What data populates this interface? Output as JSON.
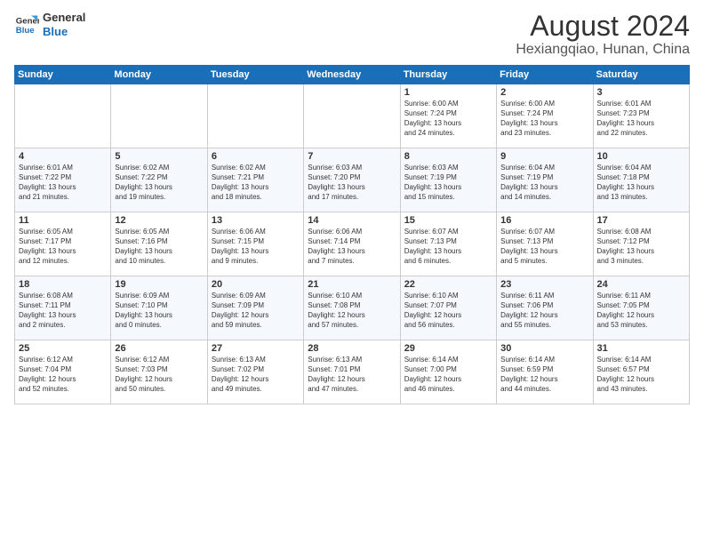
{
  "logo": {
    "line1": "General",
    "line2": "Blue"
  },
  "title": "August 2024",
  "subtitle": "Hexiangqiao, Hunan, China",
  "weekdays": [
    "Sunday",
    "Monday",
    "Tuesday",
    "Wednesday",
    "Thursday",
    "Friday",
    "Saturday"
  ],
  "weeks": [
    [
      {
        "day": "",
        "info": ""
      },
      {
        "day": "",
        "info": ""
      },
      {
        "day": "",
        "info": ""
      },
      {
        "day": "",
        "info": ""
      },
      {
        "day": "1",
        "info": "Sunrise: 6:00 AM\nSunset: 7:24 PM\nDaylight: 13 hours\nand 24 minutes."
      },
      {
        "day": "2",
        "info": "Sunrise: 6:00 AM\nSunset: 7:24 PM\nDaylight: 13 hours\nand 23 minutes."
      },
      {
        "day": "3",
        "info": "Sunrise: 6:01 AM\nSunset: 7:23 PM\nDaylight: 13 hours\nand 22 minutes."
      }
    ],
    [
      {
        "day": "4",
        "info": "Sunrise: 6:01 AM\nSunset: 7:22 PM\nDaylight: 13 hours\nand 21 minutes."
      },
      {
        "day": "5",
        "info": "Sunrise: 6:02 AM\nSunset: 7:22 PM\nDaylight: 13 hours\nand 19 minutes."
      },
      {
        "day": "6",
        "info": "Sunrise: 6:02 AM\nSunset: 7:21 PM\nDaylight: 13 hours\nand 18 minutes."
      },
      {
        "day": "7",
        "info": "Sunrise: 6:03 AM\nSunset: 7:20 PM\nDaylight: 13 hours\nand 17 minutes."
      },
      {
        "day": "8",
        "info": "Sunrise: 6:03 AM\nSunset: 7:19 PM\nDaylight: 13 hours\nand 15 minutes."
      },
      {
        "day": "9",
        "info": "Sunrise: 6:04 AM\nSunset: 7:19 PM\nDaylight: 13 hours\nand 14 minutes."
      },
      {
        "day": "10",
        "info": "Sunrise: 6:04 AM\nSunset: 7:18 PM\nDaylight: 13 hours\nand 13 minutes."
      }
    ],
    [
      {
        "day": "11",
        "info": "Sunrise: 6:05 AM\nSunset: 7:17 PM\nDaylight: 13 hours\nand 12 minutes."
      },
      {
        "day": "12",
        "info": "Sunrise: 6:05 AM\nSunset: 7:16 PM\nDaylight: 13 hours\nand 10 minutes."
      },
      {
        "day": "13",
        "info": "Sunrise: 6:06 AM\nSunset: 7:15 PM\nDaylight: 13 hours\nand 9 minutes."
      },
      {
        "day": "14",
        "info": "Sunrise: 6:06 AM\nSunset: 7:14 PM\nDaylight: 13 hours\nand 7 minutes."
      },
      {
        "day": "15",
        "info": "Sunrise: 6:07 AM\nSunset: 7:13 PM\nDaylight: 13 hours\nand 6 minutes."
      },
      {
        "day": "16",
        "info": "Sunrise: 6:07 AM\nSunset: 7:13 PM\nDaylight: 13 hours\nand 5 minutes."
      },
      {
        "day": "17",
        "info": "Sunrise: 6:08 AM\nSunset: 7:12 PM\nDaylight: 13 hours\nand 3 minutes."
      }
    ],
    [
      {
        "day": "18",
        "info": "Sunrise: 6:08 AM\nSunset: 7:11 PM\nDaylight: 13 hours\nand 2 minutes."
      },
      {
        "day": "19",
        "info": "Sunrise: 6:09 AM\nSunset: 7:10 PM\nDaylight: 13 hours\nand 0 minutes."
      },
      {
        "day": "20",
        "info": "Sunrise: 6:09 AM\nSunset: 7:09 PM\nDaylight: 12 hours\nand 59 minutes."
      },
      {
        "day": "21",
        "info": "Sunrise: 6:10 AM\nSunset: 7:08 PM\nDaylight: 12 hours\nand 57 minutes."
      },
      {
        "day": "22",
        "info": "Sunrise: 6:10 AM\nSunset: 7:07 PM\nDaylight: 12 hours\nand 56 minutes."
      },
      {
        "day": "23",
        "info": "Sunrise: 6:11 AM\nSunset: 7:06 PM\nDaylight: 12 hours\nand 55 minutes."
      },
      {
        "day": "24",
        "info": "Sunrise: 6:11 AM\nSunset: 7:05 PM\nDaylight: 12 hours\nand 53 minutes."
      }
    ],
    [
      {
        "day": "25",
        "info": "Sunrise: 6:12 AM\nSunset: 7:04 PM\nDaylight: 12 hours\nand 52 minutes."
      },
      {
        "day": "26",
        "info": "Sunrise: 6:12 AM\nSunset: 7:03 PM\nDaylight: 12 hours\nand 50 minutes."
      },
      {
        "day": "27",
        "info": "Sunrise: 6:13 AM\nSunset: 7:02 PM\nDaylight: 12 hours\nand 49 minutes."
      },
      {
        "day": "28",
        "info": "Sunrise: 6:13 AM\nSunset: 7:01 PM\nDaylight: 12 hours\nand 47 minutes."
      },
      {
        "day": "29",
        "info": "Sunrise: 6:14 AM\nSunset: 7:00 PM\nDaylight: 12 hours\nand 46 minutes."
      },
      {
        "day": "30",
        "info": "Sunrise: 6:14 AM\nSunset: 6:59 PM\nDaylight: 12 hours\nand 44 minutes."
      },
      {
        "day": "31",
        "info": "Sunrise: 6:14 AM\nSunset: 6:57 PM\nDaylight: 12 hours\nand 43 minutes."
      }
    ]
  ]
}
